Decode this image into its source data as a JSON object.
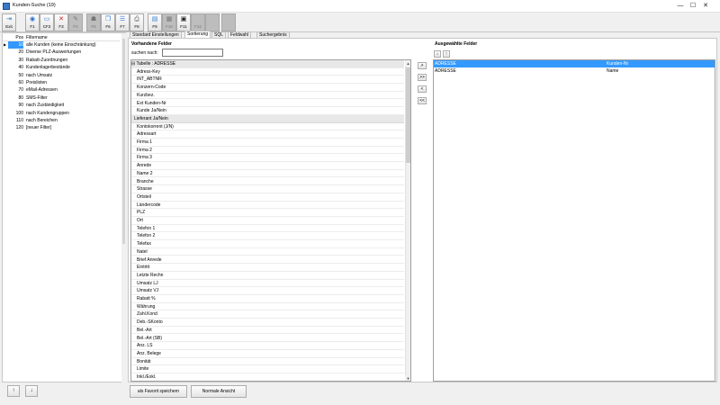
{
  "window": {
    "title": "Kunden-Suche (19)",
    "minimize": "—",
    "maximize": "☐",
    "close": "✕"
  },
  "toolbar": [
    {
      "id": "exit",
      "label": "Exit",
      "icon": "door-icon",
      "glyph": "⇥",
      "color": "#2a6fc9",
      "enabled": true
    },
    {
      "id": "f1",
      "label": "F1",
      "icon": "help-icon",
      "glyph": "◉",
      "color": "#2a6fc9",
      "enabled": true
    },
    {
      "id": "cf2",
      "label": "CF2",
      "icon": "new-document-icon",
      "glyph": "▭",
      "color": "#3a7bd5",
      "enabled": true
    },
    {
      "id": "f3",
      "label": "F3",
      "icon": "delete-icon",
      "glyph": "✕",
      "color": "#d42020",
      "enabled": true
    },
    {
      "id": "f4",
      "label": "F4",
      "icon": "edit-icon",
      "glyph": "✎",
      "color": "#777777",
      "enabled": false
    },
    {
      "id": "f5",
      "label": "F5",
      "icon": "users-icon",
      "glyph": "☗",
      "color": "#777777",
      "enabled": false
    },
    {
      "id": "f6",
      "label": "F6",
      "icon": "copy-icon",
      "glyph": "❐",
      "color": "#3a7bd5",
      "enabled": true
    },
    {
      "id": "f7",
      "label": "F7",
      "icon": "list-icon",
      "glyph": "☰",
      "color": "#3a7bd5",
      "enabled": true
    },
    {
      "id": "f8",
      "label": "F8",
      "icon": "print-icon",
      "glyph": "⎙",
      "color": "#555555",
      "enabled": true
    },
    {
      "id": "f9",
      "label": "F9",
      "icon": "filter-icon",
      "glyph": "▤",
      "color": "#3a7bd5",
      "enabled": true
    },
    {
      "id": "f10",
      "label": "F10",
      "icon": "grid-icon",
      "glyph": "▦",
      "color": "#777777",
      "enabled": false
    },
    {
      "id": "f11",
      "label": "F11",
      "icon": "table-icon",
      "glyph": "▣",
      "color": "#222222",
      "enabled": true
    },
    {
      "id": "f12",
      "label": "F12",
      "icon": "blank-icon",
      "glyph": "",
      "color": "#777777",
      "enabled": false
    },
    {
      "id": "b13",
      "label": "",
      "icon": "blank-icon",
      "glyph": "",
      "color": "#777777",
      "enabled": false
    },
    {
      "id": "b14",
      "label": "",
      "icon": "blank-icon",
      "glyph": "",
      "color": "#777777",
      "enabled": false
    }
  ],
  "filters": {
    "headers": {
      "pos": "Pos",
      "name": "Filtername"
    },
    "selected_index": 0,
    "rows": [
      {
        "pos": "10",
        "name": "alle Kunden (keine Einschränkung)"
      },
      {
        "pos": "20",
        "name": "Diverse PLZ-Auswertungen"
      },
      {
        "pos": "30",
        "name": "Rabatt-Zuordnungen"
      },
      {
        "pos": "40",
        "name": "Kundenlagerbestände"
      },
      {
        "pos": "50",
        "name": "nach Umsatz"
      },
      {
        "pos": "60",
        "name": "Preislisten"
      },
      {
        "pos": "70",
        "name": "eMail-Adressen"
      },
      {
        "pos": "80",
        "name": "SMS-Filter"
      },
      {
        "pos": "90",
        "name": "nach Zuständigkeit"
      },
      {
        "pos": "100",
        "name": "nach Kundengruppen"
      },
      {
        "pos": "110",
        "name": "nach Bereichen"
      },
      {
        "pos": "120",
        "name": "[neuer Filter]"
      }
    ]
  },
  "tabs": [
    {
      "label": "Standard Einstellungen",
      "active": false
    },
    {
      "label": "Sortierung",
      "active": true
    },
    {
      "label": "SQL",
      "active": false
    },
    {
      "label": "Feldwahl",
      "active": false
    },
    {
      "label": "Suchergebnis",
      "active": false
    }
  ],
  "available": {
    "title": "Vorhandene Felder",
    "search_label": "suchen nach:",
    "search_value": "",
    "table_header": "Tabelle : ADRESSE",
    "fields": [
      {
        "label": "Adress-Key"
      },
      {
        "label": "INT_ABTNR"
      },
      {
        "label": "Konzern-Code"
      },
      {
        "label": "Kurzbez."
      },
      {
        "label": "Ext Kunden-Nr"
      },
      {
        "label": "Kunde Ja/Nein"
      },
      {
        "label": "Lieferant Ja/Nein",
        "group": true
      },
      {
        "label": "Kontokorrent (J/N)"
      },
      {
        "label": "Adressart"
      },
      {
        "label": "Firma 1"
      },
      {
        "label": "Firma 2"
      },
      {
        "label": "Firma 3"
      },
      {
        "label": "Anrede"
      },
      {
        "label": "Name 2"
      },
      {
        "label": "Branche"
      },
      {
        "label": "Strasse"
      },
      {
        "label": "Ortsteil"
      },
      {
        "label": "Ländercode"
      },
      {
        "label": "PLZ"
      },
      {
        "label": "Ort"
      },
      {
        "label": "Telefon 1"
      },
      {
        "label": "Telefon 2"
      },
      {
        "label": "Telefax"
      },
      {
        "label": "Natel"
      },
      {
        "label": "Brief Anrede"
      },
      {
        "label": "Eintritt"
      },
      {
        "label": "Letzte Rechn"
      },
      {
        "label": "Umsatz LJ"
      },
      {
        "label": "Umsatz VJ"
      },
      {
        "label": "Rabatt %"
      },
      {
        "label": "Währung"
      },
      {
        "label": "Zahl.Kond"
      },
      {
        "label": "Deb.-SKonto"
      },
      {
        "label": "Bel.-Art"
      },
      {
        "label": "Bel.-Art (SB)"
      },
      {
        "label": "Anz. LS"
      },
      {
        "label": "Anz. Belege"
      },
      {
        "label": "Bonität"
      },
      {
        "label": "Limite"
      },
      {
        "label": "Inkl./Exkl."
      }
    ]
  },
  "move_buttons": {
    "add": ">",
    "add_all": ">>",
    "remove": "<",
    "remove_all": "<<"
  },
  "selected": {
    "title": "Ausgewählte Felder",
    "down": "↓",
    "up": "↑",
    "selected_index": 0,
    "rows": [
      {
        "table": "ADRESSE",
        "field": "Kunden-Nr"
      },
      {
        "table": "ADRESSE",
        "field": "Name"
      }
    ]
  },
  "bottom": {
    "nav_up": "↑",
    "nav_down": "↓",
    "save_default": "als Favorit speichern",
    "normal_view": "Normale Ansicht"
  },
  "colors": {
    "selection": "#3399ff",
    "accent": "#2a6fc9"
  }
}
